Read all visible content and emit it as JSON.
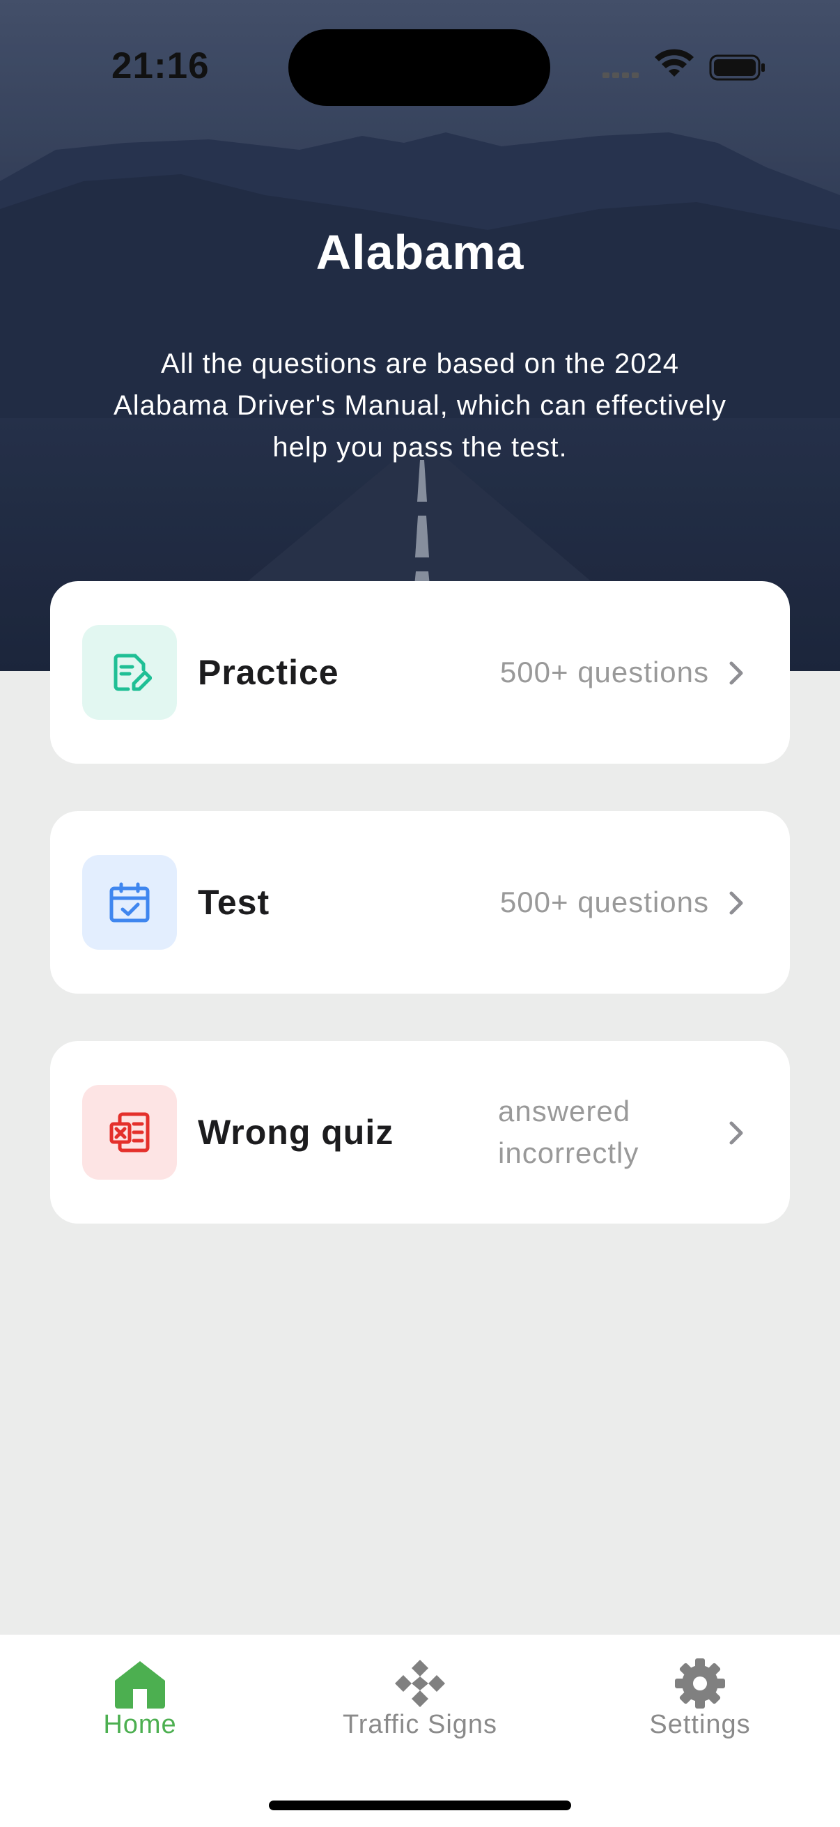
{
  "status_bar": {
    "time": "21:16"
  },
  "hero": {
    "title": "Alabama",
    "description": "All the questions are based on the 2024 Alabama Driver's Manual, which can effectively help you pass the test."
  },
  "cards": [
    {
      "label": "Practice",
      "meta": "500+ questions",
      "icon": "document-edit-icon",
      "icon_bg": "#e2f7f1",
      "icon_color": "#1fbf95"
    },
    {
      "label": "Test",
      "meta": "500+ questions",
      "icon": "calendar-check-icon",
      "icon_bg": "#e3eefe",
      "icon_color": "#3f86ef"
    },
    {
      "label": "Wrong quiz",
      "meta": "answered incorrectly",
      "icon": "wrong-answer-icon",
      "icon_bg": "#fde4e4",
      "icon_color": "#e4302b"
    }
  ],
  "tabbar": {
    "tabs": [
      {
        "label": "Home",
        "icon": "home-icon",
        "active": true
      },
      {
        "label": "Traffic Signs",
        "icon": "traffic-signs-icon",
        "active": false
      },
      {
        "label": "Settings",
        "icon": "gear-icon",
        "active": false
      }
    ],
    "active_color": "#4caf50",
    "inactive_color": "#8a8a8a"
  }
}
